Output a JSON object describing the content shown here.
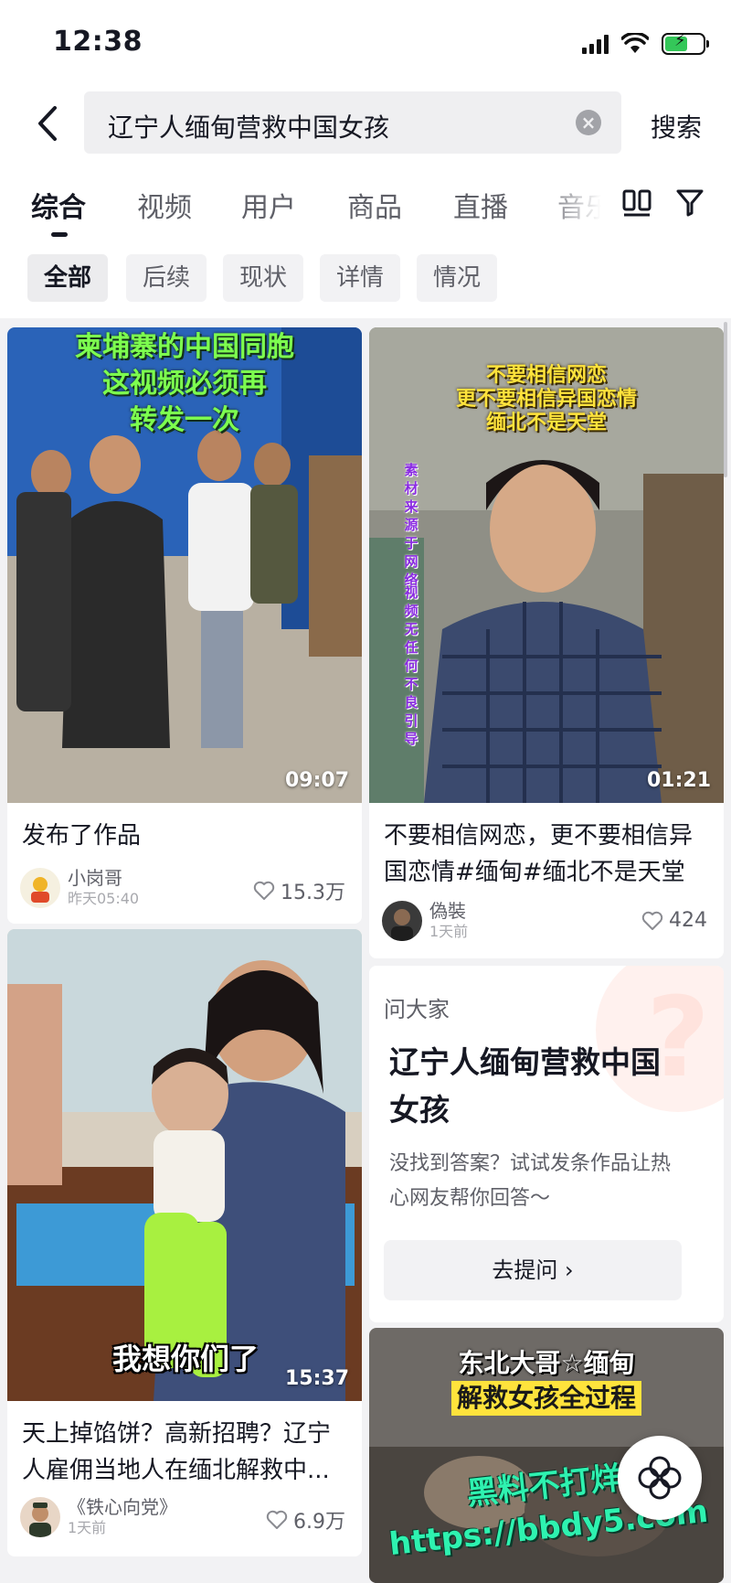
{
  "status_bar": {
    "time": "12:38"
  },
  "search": {
    "query": "辽宁人缅甸营救中国女孩",
    "submit_label": "搜索"
  },
  "tabs": [
    {
      "label": "综合",
      "active": true
    },
    {
      "label": "视频"
    },
    {
      "label": "用户"
    },
    {
      "label": "商品"
    },
    {
      "label": "直播"
    },
    {
      "label": "音乐"
    }
  ],
  "filter_chips": [
    {
      "label": "全部",
      "active": true
    },
    {
      "label": "后续"
    },
    {
      "label": "现状"
    },
    {
      "label": "详情"
    },
    {
      "label": "情况"
    }
  ],
  "results": [
    {
      "overlay_lines": [
        "柬埔寨的中国同胞",
        "这视频必须再",
        "转发一次"
      ],
      "duration": "09:07",
      "title": "发布了作品",
      "author": "小岗哥",
      "time": "昨天05:40",
      "likes": "15.3万"
    },
    {
      "overlay_lines": [
        "不要相信网恋",
        "更不要相信异国恋情",
        "缅北不是天堂"
      ],
      "side_text": "素材来源于网络",
      "side_text_2": "视频无任何不良引导",
      "duration": "01:21",
      "title_lines": [
        "不要相信网恋，更不要相信异",
        "国恋情#缅甸#缅北不是天堂"
      ],
      "author": "偽裝",
      "time": "1天前",
      "likes": "424"
    },
    {
      "overlay_bottom": "我想你们了",
      "duration": "15:37",
      "title_lines": [
        "天上掉馅饼？高新招聘？辽宁",
        "人雇佣当地人在缅北解救中..."
      ],
      "author": "《铁心向党》",
      "time": "1天前",
      "likes": "6.9万"
    },
    {
      "overlay_lines": [
        "东北大哥☆缅甸",
        "解救女孩全过程"
      ],
      "watermark_lines": [
        "黑料不打烊",
        "https://bbdy5.com"
      ]
    }
  ],
  "ask": {
    "label": "问大家",
    "title": "辽宁人缅甸营救中国女孩",
    "description": "没找到答案？试试发条作品让热心网友帮你回答～",
    "button_label": "去提问 ›"
  },
  "colors": {
    "overlay_green": "#7dff4f",
    "overlay_yellow": "#ffe33c",
    "overlay_purple": "#8a2be2"
  }
}
